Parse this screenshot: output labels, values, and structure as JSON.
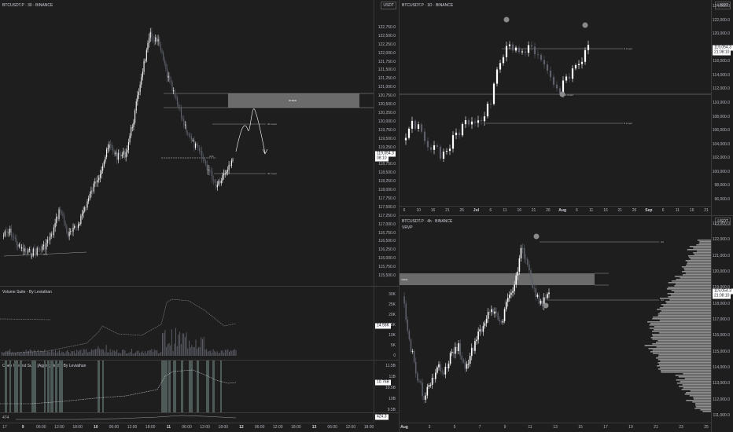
{
  "left": {
    "title": "BTCUSDT.P · 30 · BINANCE",
    "unit": "USDT",
    "price_ticks": [
      "122,750.0",
      "122,500.0",
      "122,250.0",
      "122,000.0",
      "121,750.0",
      "121,500.0",
      "121,250.0",
      "121,000.0",
      "120,750.0",
      "120,500.0",
      "120,250.0",
      "120,000.0",
      "119,750.0",
      "119,500.0",
      "119,250.0",
      "119,000.0",
      "118,750.0",
      "118,500.0",
      "118,250.0",
      "118,000.0",
      "117,750.0",
      "117,500.0",
      "117,250.0",
      "117,000.0",
      "116,750.0",
      "116,500.0",
      "116,250.0",
      "116,000.0",
      "115,750.0",
      "115,500.0"
    ],
    "price_tag": "119,054.3",
    "price_tag_time": "08:10",
    "fvg_label": "30 EFE",
    "level_upper": "30 invent",
    "level_lower": "30 invent",
    "dashed_label": "H30",
    "ssl_label": "SSL",
    "volume": {
      "title": "Volume Suite - By Leviathan",
      "ticks": [
        "30K",
        "25K",
        "20K",
        "15K",
        "10K",
        "5K",
        "0"
      ],
      "value_tag": "14.56K"
    },
    "oi": {
      "title": "Open Interest Suite [Aggregated] - By Leviathan",
      "ticks": [
        "11.5B",
        "11B",
        "10.5B",
        "10B",
        "9.5B"
      ],
      "value_tag": "10.76B"
    },
    "strip": {
      "label": "474",
      "value_tag": "424.3"
    },
    "xaxis": [
      "17",
      "9",
      "06:00",
      "12:00",
      "18:00",
      "10",
      "06:00",
      "12:00",
      "18:00",
      "11",
      "06:00",
      "12:00",
      "18:00",
      "12",
      "06:00",
      "12:00",
      "18:00",
      "13",
      "06:00",
      "12:00",
      "18:00"
    ],
    "xaxis_bold": [
      "9",
      "10",
      "11",
      "12",
      "13"
    ]
  },
  "topright": {
    "title": "BTCUSDT.P · 1D · BINANCE",
    "unit": "USDT",
    "price_ticks": [
      "124,000.0",
      "122,000.0",
      "120,000.0",
      "118,000.0",
      "116,000.0",
      "114,000.0",
      "112,000.0",
      "110,000.0",
      "108,000.0",
      "106,000.0",
      "104,000.0",
      "102,000.0",
      "100,000.0",
      "98,000.0",
      "96,000.0"
    ],
    "price_tag": "119,054.3",
    "price_tag_time": "21:08:10",
    "level_upper": "D invent",
    "level_mid": "D invent",
    "level_lower": "D invent",
    "xaxis": [
      "6",
      "10",
      "16",
      "21",
      "26",
      "Jul",
      "6",
      "11",
      "16",
      "21",
      "26",
      "Aug",
      "6",
      "11",
      "16",
      "21",
      "26",
      "Sep",
      "6",
      "11",
      "16",
      "21"
    ],
    "xaxis_bold": [
      "Jul",
      "Aug",
      "Sep"
    ]
  },
  "bottomright": {
    "title": "BTCUSDT.P · 4h · BINANCE",
    "indicator": "VRVP",
    "unit": "USDT",
    "price_ticks": [
      "123,000.0",
      "122,000.0",
      "121,000.0",
      "120,000.0",
      "119,000.0",
      "118,000.0",
      "117,000.0",
      "116,000.0",
      "115,000.0",
      "114,000.0",
      "113,000.0",
      "112,000.0",
      "111,000.0"
    ],
    "price_tag": "119,054.3",
    "price_tag_time": "21:08:10",
    "fvg_label": "4 EFE",
    "level_upper": "4H",
    "level_lower": "4H",
    "xaxis": [
      "Aug",
      "3",
      "5",
      "7",
      "9",
      "11",
      "13",
      "15",
      "17",
      "19",
      "21",
      "23",
      "25"
    ],
    "xaxis_bold": [
      "Aug"
    ]
  },
  "colors": {
    "background": "#1e1e1e",
    "candle_up": "#ffffff",
    "candle_down": "#5d606b",
    "fvg_box": "#6b6b6b",
    "grid": "#3a3a3a",
    "oi_band": "#4d5a57"
  }
}
